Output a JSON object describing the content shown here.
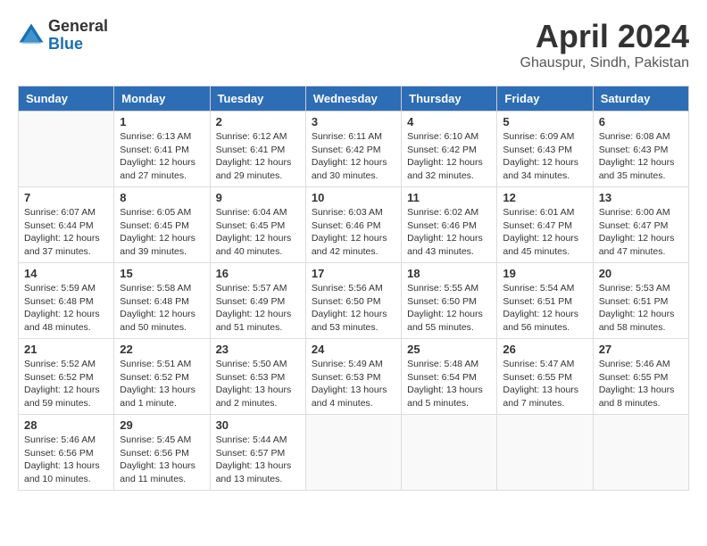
{
  "header": {
    "logo_general": "General",
    "logo_blue": "Blue",
    "month": "April 2024",
    "location": "Ghauspur, Sindh, Pakistan"
  },
  "weekdays": [
    "Sunday",
    "Monday",
    "Tuesday",
    "Wednesday",
    "Thursday",
    "Friday",
    "Saturday"
  ],
  "weeks": [
    [
      {
        "day": "",
        "sunrise": "",
        "sunset": "",
        "daylight": ""
      },
      {
        "day": "1",
        "sunrise": "Sunrise: 6:13 AM",
        "sunset": "Sunset: 6:41 PM",
        "daylight": "Daylight: 12 hours and 27 minutes."
      },
      {
        "day": "2",
        "sunrise": "Sunrise: 6:12 AM",
        "sunset": "Sunset: 6:41 PM",
        "daylight": "Daylight: 12 hours and 29 minutes."
      },
      {
        "day": "3",
        "sunrise": "Sunrise: 6:11 AM",
        "sunset": "Sunset: 6:42 PM",
        "daylight": "Daylight: 12 hours and 30 minutes."
      },
      {
        "day": "4",
        "sunrise": "Sunrise: 6:10 AM",
        "sunset": "Sunset: 6:42 PM",
        "daylight": "Daylight: 12 hours and 32 minutes."
      },
      {
        "day": "5",
        "sunrise": "Sunrise: 6:09 AM",
        "sunset": "Sunset: 6:43 PM",
        "daylight": "Daylight: 12 hours and 34 minutes."
      },
      {
        "day": "6",
        "sunrise": "Sunrise: 6:08 AM",
        "sunset": "Sunset: 6:43 PM",
        "daylight": "Daylight: 12 hours and 35 minutes."
      }
    ],
    [
      {
        "day": "7",
        "sunrise": "Sunrise: 6:07 AM",
        "sunset": "Sunset: 6:44 PM",
        "daylight": "Daylight: 12 hours and 37 minutes."
      },
      {
        "day": "8",
        "sunrise": "Sunrise: 6:05 AM",
        "sunset": "Sunset: 6:45 PM",
        "daylight": "Daylight: 12 hours and 39 minutes."
      },
      {
        "day": "9",
        "sunrise": "Sunrise: 6:04 AM",
        "sunset": "Sunset: 6:45 PM",
        "daylight": "Daylight: 12 hours and 40 minutes."
      },
      {
        "day": "10",
        "sunrise": "Sunrise: 6:03 AM",
        "sunset": "Sunset: 6:46 PM",
        "daylight": "Daylight: 12 hours and 42 minutes."
      },
      {
        "day": "11",
        "sunrise": "Sunrise: 6:02 AM",
        "sunset": "Sunset: 6:46 PM",
        "daylight": "Daylight: 12 hours and 43 minutes."
      },
      {
        "day": "12",
        "sunrise": "Sunrise: 6:01 AM",
        "sunset": "Sunset: 6:47 PM",
        "daylight": "Daylight: 12 hours and 45 minutes."
      },
      {
        "day": "13",
        "sunrise": "Sunrise: 6:00 AM",
        "sunset": "Sunset: 6:47 PM",
        "daylight": "Daylight: 12 hours and 47 minutes."
      }
    ],
    [
      {
        "day": "14",
        "sunrise": "Sunrise: 5:59 AM",
        "sunset": "Sunset: 6:48 PM",
        "daylight": "Daylight: 12 hours and 48 minutes."
      },
      {
        "day": "15",
        "sunrise": "Sunrise: 5:58 AM",
        "sunset": "Sunset: 6:48 PM",
        "daylight": "Daylight: 12 hours and 50 minutes."
      },
      {
        "day": "16",
        "sunrise": "Sunrise: 5:57 AM",
        "sunset": "Sunset: 6:49 PM",
        "daylight": "Daylight: 12 hours and 51 minutes."
      },
      {
        "day": "17",
        "sunrise": "Sunrise: 5:56 AM",
        "sunset": "Sunset: 6:50 PM",
        "daylight": "Daylight: 12 hours and 53 minutes."
      },
      {
        "day": "18",
        "sunrise": "Sunrise: 5:55 AM",
        "sunset": "Sunset: 6:50 PM",
        "daylight": "Daylight: 12 hours and 55 minutes."
      },
      {
        "day": "19",
        "sunrise": "Sunrise: 5:54 AM",
        "sunset": "Sunset: 6:51 PM",
        "daylight": "Daylight: 12 hours and 56 minutes."
      },
      {
        "day": "20",
        "sunrise": "Sunrise: 5:53 AM",
        "sunset": "Sunset: 6:51 PM",
        "daylight": "Daylight: 12 hours and 58 minutes."
      }
    ],
    [
      {
        "day": "21",
        "sunrise": "Sunrise: 5:52 AM",
        "sunset": "Sunset: 6:52 PM",
        "daylight": "Daylight: 12 hours and 59 minutes."
      },
      {
        "day": "22",
        "sunrise": "Sunrise: 5:51 AM",
        "sunset": "Sunset: 6:52 PM",
        "daylight": "Daylight: 13 hours and 1 minute."
      },
      {
        "day": "23",
        "sunrise": "Sunrise: 5:50 AM",
        "sunset": "Sunset: 6:53 PM",
        "daylight": "Daylight: 13 hours and 2 minutes."
      },
      {
        "day": "24",
        "sunrise": "Sunrise: 5:49 AM",
        "sunset": "Sunset: 6:53 PM",
        "daylight": "Daylight: 13 hours and 4 minutes."
      },
      {
        "day": "25",
        "sunrise": "Sunrise: 5:48 AM",
        "sunset": "Sunset: 6:54 PM",
        "daylight": "Daylight: 13 hours and 5 minutes."
      },
      {
        "day": "26",
        "sunrise": "Sunrise: 5:47 AM",
        "sunset": "Sunset: 6:55 PM",
        "daylight": "Daylight: 13 hours and 7 minutes."
      },
      {
        "day": "27",
        "sunrise": "Sunrise: 5:46 AM",
        "sunset": "Sunset: 6:55 PM",
        "daylight": "Daylight: 13 hours and 8 minutes."
      }
    ],
    [
      {
        "day": "28",
        "sunrise": "Sunrise: 5:46 AM",
        "sunset": "Sunset: 6:56 PM",
        "daylight": "Daylight: 13 hours and 10 minutes."
      },
      {
        "day": "29",
        "sunrise": "Sunrise: 5:45 AM",
        "sunset": "Sunset: 6:56 PM",
        "daylight": "Daylight: 13 hours and 11 minutes."
      },
      {
        "day": "30",
        "sunrise": "Sunrise: 5:44 AM",
        "sunset": "Sunset: 6:57 PM",
        "daylight": "Daylight: 13 hours and 13 minutes."
      },
      {
        "day": "",
        "sunrise": "",
        "sunset": "",
        "daylight": ""
      },
      {
        "day": "",
        "sunrise": "",
        "sunset": "",
        "daylight": ""
      },
      {
        "day": "",
        "sunrise": "",
        "sunset": "",
        "daylight": ""
      },
      {
        "day": "",
        "sunrise": "",
        "sunset": "",
        "daylight": ""
      }
    ]
  ]
}
